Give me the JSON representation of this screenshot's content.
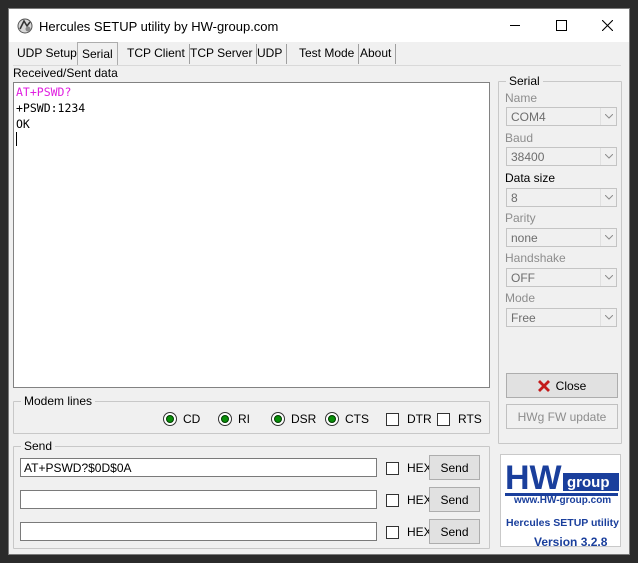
{
  "window": {
    "title": "Hercules SETUP utility by HW-group.com"
  },
  "tabs": [
    "UDP Setup",
    "Serial",
    "TCP Client",
    "TCP Server",
    "UDP",
    "Test Mode",
    "About"
  ],
  "received": {
    "label": "Received/Sent data",
    "lines": [
      {
        "text": "AT+PSWD?",
        "color": "#e020e0"
      },
      {
        "text": "+PSWD:1234",
        "color": "#000000"
      },
      {
        "text": "OK",
        "color": "#000000"
      }
    ]
  },
  "serial": {
    "title": "Serial",
    "name_label": "Name",
    "name_value": "COM4",
    "baud_label": "Baud",
    "baud_value": "38400",
    "datasize_label": "Data size",
    "datasize_value": "8",
    "parity_label": "Parity",
    "parity_value": "none",
    "handshake_label": "Handshake",
    "handshake_value": "OFF",
    "mode_label": "Mode",
    "mode_value": "Free",
    "close_label": "Close",
    "fw_label": "HWg FW update"
  },
  "modem": {
    "title": "Modem lines",
    "cd": "CD",
    "ri": "RI",
    "dsr": "DSR",
    "cts": "CTS",
    "dtr": "DTR",
    "rts": "RTS"
  },
  "send": {
    "title": "Send",
    "rows": [
      {
        "value": "AT+PSWD?$0D$0A",
        "hex": "HEX",
        "button": "Send"
      },
      {
        "value": "",
        "hex": "HEX",
        "button": "Send"
      },
      {
        "value": "",
        "hex": "HEX",
        "button": "Send"
      }
    ]
  },
  "logo": {
    "hw": "HW",
    "group": "group",
    "url": "www.HW-group.com",
    "product": "Hercules SETUP utility",
    "version": "Version  3.2.8"
  },
  "colors": {
    "accent": "#1a3f9c",
    "indicator": "#0a8f0a",
    "close_icon": "#c41a1a"
  }
}
